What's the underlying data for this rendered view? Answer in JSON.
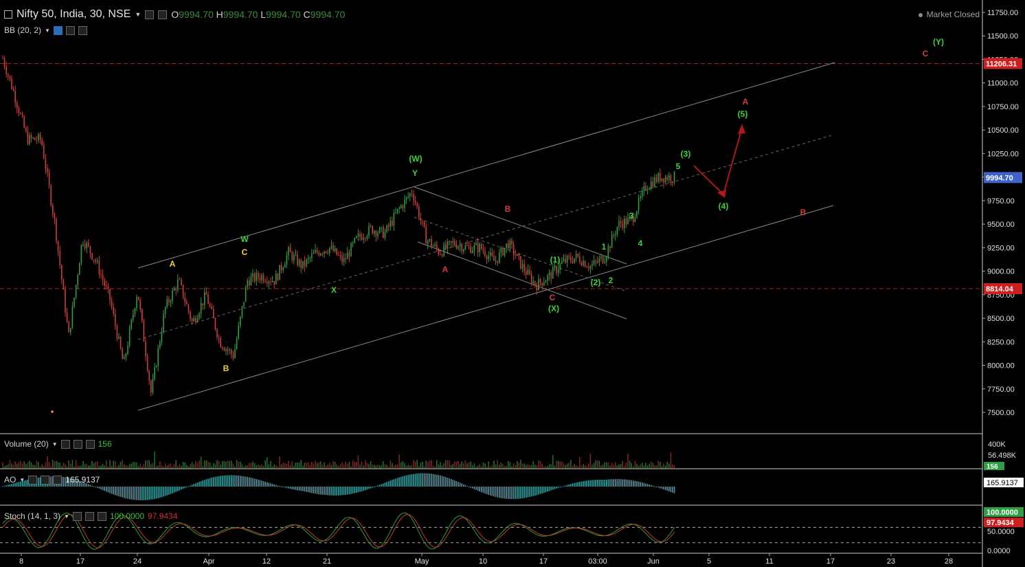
{
  "header": {
    "symbol": "Nifty 50, India, 30, NSE",
    "o_label": "O",
    "o_value": "9994.70",
    "h_label": "H",
    "h_value": "9994.70",
    "l_label": "L",
    "l_value": "9994.70",
    "c_label": "C",
    "c_value": "9994.70",
    "market_status": "Market Closed"
  },
  "indicators": {
    "bb": "BB (20, 2)",
    "volume": "Volume (20)",
    "volume_value": "156",
    "ao": "AO",
    "ao_value": "165.9137",
    "stoch": "Stoch (14, 1, 3)",
    "stoch_k": "100.0000",
    "stoch_d": "97.9434"
  },
  "chart_data": {
    "type": "candlestick",
    "price_axis": [
      "11750.00",
      "11500.00",
      "11250.00",
      "11000.00",
      "10750.00",
      "10500.00",
      "10250.00",
      "10000.00",
      "9750.00",
      "9500.00",
      "9250.00",
      "9000.00",
      "8750.00",
      "8500.00",
      "8250.00",
      "8000.00",
      "7750.00",
      "7500.00"
    ],
    "price_range": [
      7250,
      11850
    ],
    "time_axis": [
      "8",
      "17",
      "24",
      "Apr",
      "12",
      "21",
      "May",
      "10",
      "17",
      "03:00",
      "Jun",
      "5",
      "11",
      "17",
      "23",
      "28"
    ],
    "price_badges": [
      {
        "label": "11206.31",
        "value": 11206.31,
        "color": "#cc1f1f"
      },
      {
        "label": "9994.70",
        "value": 9994.7,
        "color": "#3f63c8"
      },
      {
        "label": "8814.04",
        "value": 8814.04,
        "color": "#cc1f1f"
      }
    ],
    "hlines": [
      11206.31,
      8814.04
    ],
    "volume_axis": [
      "400K",
      "56.498K"
    ],
    "volume_badge": "156",
    "ao_badge": "165.9137",
    "stoch_axis": [
      "100.0000",
      "97.9434",
      "50.0000",
      "0.0000"
    ],
    "wave_labels": [
      {
        "text": "(Y)",
        "color": "#3cd23c"
      },
      {
        "text": "C",
        "color": "#d83c3c"
      },
      {
        "text": "A",
        "color": "#d83c3c"
      },
      {
        "text": "(5)",
        "color": "#3cd23c"
      },
      {
        "text": "(3)",
        "color": "#3cd23c"
      },
      {
        "text": "5",
        "color": "#3cd23c"
      },
      {
        "text": "(4)",
        "color": "#3cd23c"
      },
      {
        "text": "B",
        "color": "#d83c3c"
      },
      {
        "text": "(W)",
        "color": "#3cd23c"
      },
      {
        "text": "Y",
        "color": "#3cd23c"
      },
      {
        "text": "W",
        "color": "#3cd23c"
      },
      {
        "text": "C",
        "color": "#f0d23c"
      },
      {
        "text": "A",
        "color": "#f0d23c"
      },
      {
        "text": "B",
        "color": "#f0d23c"
      },
      {
        "text": "X",
        "color": "#3cd23c"
      },
      {
        "text": "A",
        "color": "#d83c3c"
      },
      {
        "text": "B",
        "color": "#d83c3c"
      },
      {
        "text": "C",
        "color": "#d83c3c"
      },
      {
        "text": "(X)",
        "color": "#3cd23c"
      },
      {
        "text": "(1)",
        "color": "#3cd23c"
      },
      {
        "text": "(2)",
        "color": "#3cd23c"
      },
      {
        "text": "1",
        "color": "#3cd23c"
      },
      {
        "text": "2",
        "color": "#3cd23c"
      },
      {
        "text": "3",
        "color": "#3cd23c"
      },
      {
        "text": "4",
        "color": "#3cd23c"
      }
    ]
  }
}
